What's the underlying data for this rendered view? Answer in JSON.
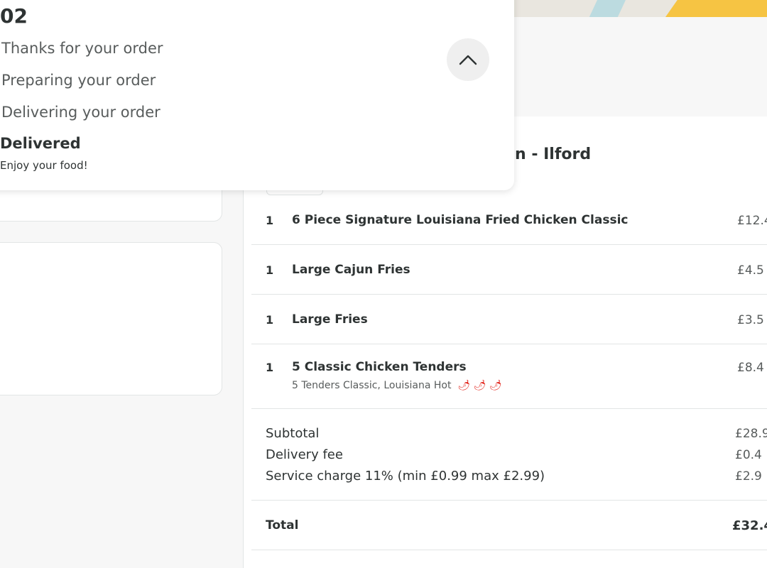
{
  "order_status": {
    "order_number": "02",
    "steps": [
      {
        "label": "Thanks for your order"
      },
      {
        "label": "Preparing your order"
      },
      {
        "label": "Delivering your order"
      }
    ],
    "current_step": "Delivered",
    "current_step_sub": "Enjoy your food!",
    "collapse_icon": "chevron-up-icon"
  },
  "order": {
    "restaurant_name": "cken - Ilford",
    "items": [
      {
        "qty": "1",
        "name": "6 Piece Signature Louisiana Fried Chicken Classic",
        "price": "£12.4",
        "desc": ""
      },
      {
        "qty": "1",
        "name": "Large Cajun Fries",
        "price": "£4.5",
        "desc": ""
      },
      {
        "qty": "1",
        "name": "Large Fries",
        "price": "£3.5",
        "desc": ""
      },
      {
        "qty": "1",
        "name": "5 Classic Chicken Tenders",
        "price": "£8.4",
        "desc": "5 Tenders Classic, Louisiana Hot",
        "spice_icon": "chili-pepper-icon",
        "spice_level": 3
      }
    ],
    "summary": {
      "subtotal_label": "Subtotal",
      "subtotal": "£28.9",
      "delivery_label": "Delivery fee",
      "delivery": "£0.4",
      "service_label": "Service charge 11% (min £0.99 max £2.99)",
      "service": "£2.9",
      "total_label": "Total",
      "total": "£32.4"
    }
  },
  "colors": {
    "text_primary": "#2e3333",
    "text_secondary": "#585c5c",
    "divider": "#e2e5e5",
    "chili": "#e2231a",
    "map_yellow": "#f6c443",
    "map_blue": "#bcdbe0"
  }
}
